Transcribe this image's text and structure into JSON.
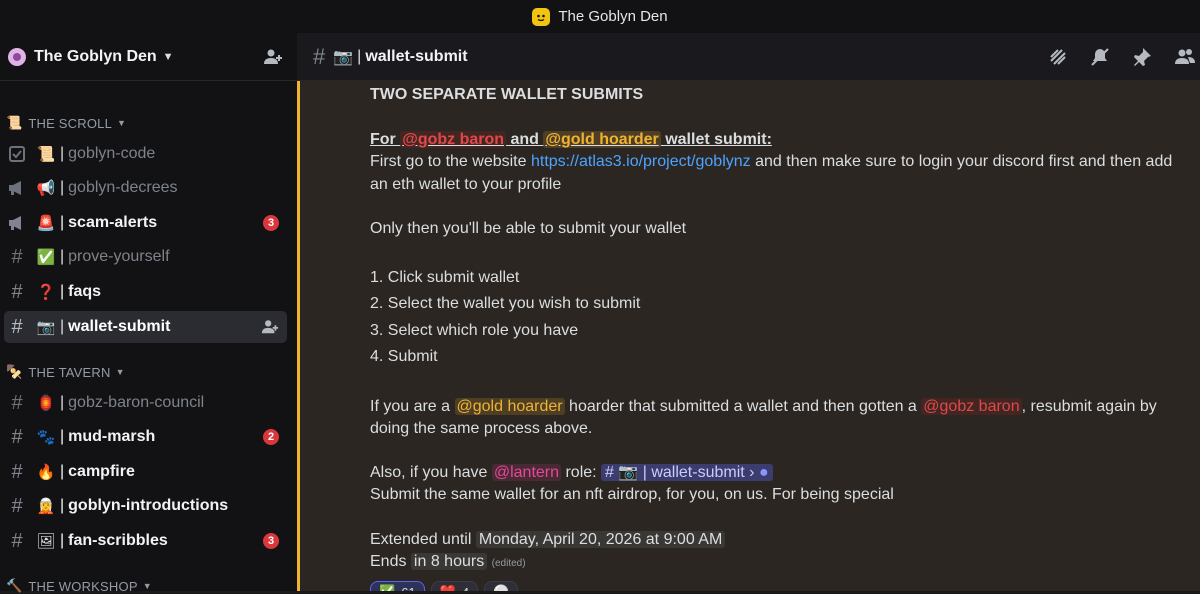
{
  "window": {
    "title": "The Goblyn Den"
  },
  "server": {
    "name": "The Goblyn Den"
  },
  "sidebar": {
    "categories": [
      {
        "emoji": "📜",
        "label": "THE SCROLL"
      },
      {
        "emoji": "🍢",
        "label": "THE TAVERN"
      },
      {
        "emoji": "🔨",
        "label": "THE WORKSHOP"
      }
    ],
    "channels": [
      {
        "emoji": "📜",
        "label": "goblyn-code",
        "state": "read"
      },
      {
        "emoji": "📢",
        "label": "goblyn-decrees",
        "state": "read"
      },
      {
        "emoji": "🚨",
        "label": "scam-alerts",
        "state": "unread",
        "badge": "3"
      },
      {
        "emoji": "✅",
        "label": "prove-yourself",
        "state": "read"
      },
      {
        "emoji": "❓",
        "label": "faqs",
        "state": "unread"
      },
      {
        "emoji": "📷",
        "label": "wallet-submit",
        "state": "active"
      },
      {
        "emoji": "🏮",
        "label": "gobz-baron-council",
        "state": "read"
      },
      {
        "emoji": "🐾",
        "label": "mud-marsh",
        "state": "unread",
        "badge": "2"
      },
      {
        "emoji": "🔥",
        "label": "campfire",
        "state": "unread"
      },
      {
        "emoji": "🧝",
        "label": "goblyn-introductions",
        "state": "unread"
      },
      {
        "emoji": "🖼",
        "label": "fan-scribbles",
        "state": "unread",
        "badge": "3"
      }
    ]
  },
  "channel_header": {
    "emoji": "📷",
    "separator": "|",
    "name": "wallet-submit"
  },
  "message": {
    "heading": "TWO SEPARATE WALLET SUBMITS",
    "for_prefix": "For ",
    "mention_baron": "@gobz baron",
    "and": " and ",
    "mention_hoarder": "@gold hoarder",
    "for_suffix": " wallet submit:",
    "line1a": "First go to the website ",
    "link": "https://atlas3.io/project/goblynz",
    "line1b": " and then make sure to login your discord first and then add",
    "line2": "an eth wallet to your profile",
    "line3": "Only then you'll be able to submit your wallet",
    "steps": [
      "1. Click submit wallet",
      "2. Select the wallet you wish to submit",
      "3. Select which role you have",
      "4. Submit"
    ],
    "if_prefix": "If you are a ",
    "if_mid": " hoarder that submitted a wallet and then gotten a ",
    "if_suffix": ", resubmit again by",
    "line_same": "doing the same process above.",
    "also_prefix": "Also, if you have ",
    "mention_lantern": "@lantern",
    "also_mid": " role: ",
    "chan_ref": "# 📷 | wallet-submit ›",
    "line_airdrop": "Submit the same wallet for an nft airdrop, for you, on us. For being special",
    "ext_prefix": "Extended until ",
    "ext_date": "Monday, April 20, 2026 at 9:00 AM",
    "ends_prefix": "Ends ",
    "ends_value": "in 8 hours",
    "edited": "(edited)"
  },
  "reactions": [
    {
      "emoji": "✅",
      "count": "61"
    },
    {
      "emoji": "❤️",
      "count": "4"
    },
    {
      "emoji": "⚪",
      "count": ""
    }
  ],
  "colors": {
    "accent": "#f0b232",
    "mention_red": "#e0484a",
    "badge": "#da373c",
    "link": "#4da3ff"
  }
}
